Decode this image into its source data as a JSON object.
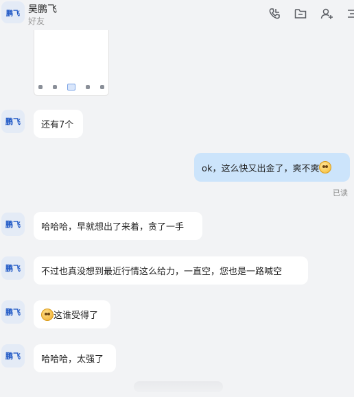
{
  "header": {
    "avatar_text": "鹏飞",
    "contact_name": "吴鹏飞",
    "contact_status": "好友",
    "icons": [
      "phone-icon",
      "folder-icon",
      "add-user-icon",
      "more-icon"
    ]
  },
  "messages": [
    {
      "sender": "other",
      "avatar_text": "鹏飞",
      "text": "还有7个"
    },
    {
      "sender": "me",
      "text": "ok，这么快又出金了，爽不爽",
      "emoji": "smile-emoji",
      "status": "已读"
    },
    {
      "sender": "other",
      "avatar_text": "鹏飞",
      "text": "哈哈哈，早就想出了来着，贪了一手"
    },
    {
      "sender": "other",
      "avatar_text": "鹏飞",
      "text": "不过也真没想到最近行情这么给力，一直空，您也是一路喊空"
    },
    {
      "sender": "other",
      "avatar_text": "鹏飞",
      "emoji": "laugh-cry-emoji",
      "text": "这谁受得了"
    },
    {
      "sender": "other",
      "avatar_text": "鹏飞",
      "text": "哈哈哈，太强了"
    }
  ]
}
